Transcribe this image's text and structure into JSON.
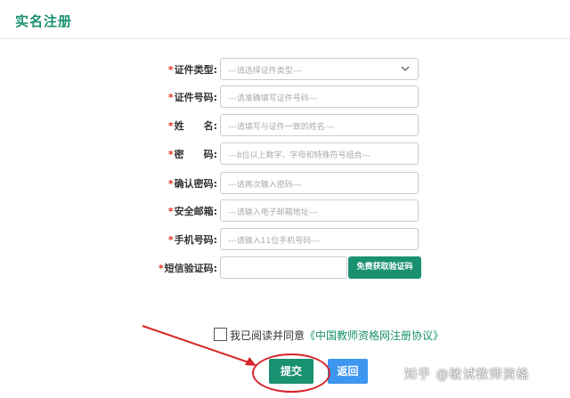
{
  "header": {
    "title": "实名注册"
  },
  "form": {
    "required_mark": "*",
    "fields": [
      {
        "label": "证件类型:",
        "placeholder": "---请选择证件类型---"
      },
      {
        "label": "证件号码:",
        "placeholder": "---请准确填写证件号码---"
      },
      {
        "label": "姓　　名:",
        "placeholder": "---请填写与证件一致的姓名---"
      },
      {
        "label": "密　　码:",
        "placeholder": "---8位以上数字、字母和特殊符号组合---"
      },
      {
        "label": "确认密码:",
        "placeholder": "---请再次输入密码---"
      },
      {
        "label": "安全邮箱:",
        "placeholder": "---请输入电子邮箱地址---"
      },
      {
        "label": "手机号码:",
        "placeholder": "---请输入11位手机号码---"
      },
      {
        "label": "短信验证码:",
        "placeholder": ""
      }
    ],
    "sms_button": "免费获取验证码"
  },
  "agreement": {
    "text": "我已阅读并同意",
    "link": "《中国教师资格网注册协议》",
    "checked": false
  },
  "actions": {
    "submit": "提交",
    "back": "返回"
  },
  "annotation": {
    "color": "#d6272a"
  },
  "watermark": "知乎 @敏试教师资格",
  "colors": {
    "accent": "#1a9170",
    "secondary": "#3d96f0",
    "required": "#e0301e"
  }
}
